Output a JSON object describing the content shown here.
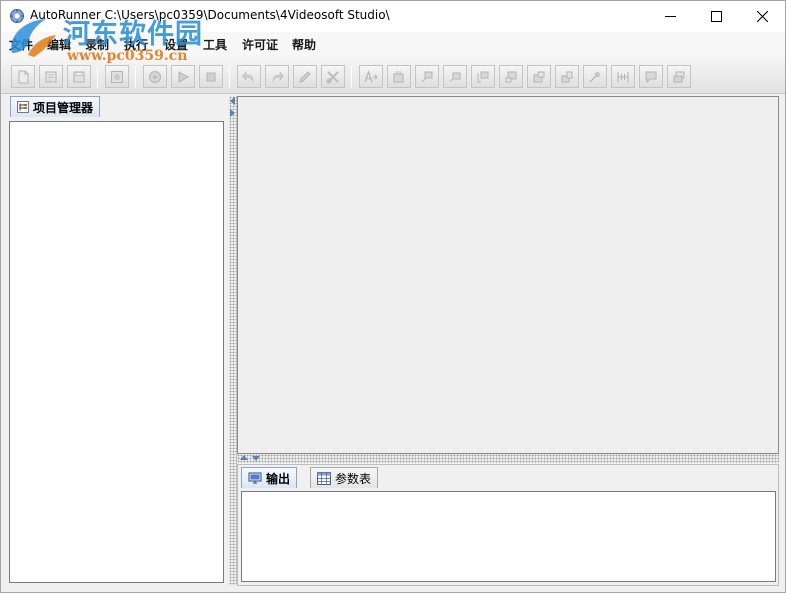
{
  "window": {
    "title": "AutoRunner  C:\\Users\\pc0359\\Documents\\4Videosoft Studio\\",
    "controls": {
      "minimize": "minimize-icon",
      "maximize": "maximize-icon",
      "close": "close-icon"
    }
  },
  "watermark": {
    "name": "河东软件园",
    "url": "www.pc0359.cn"
  },
  "menu": {
    "items": [
      {
        "label": "文件"
      },
      {
        "label": "编辑"
      },
      {
        "label": "录制"
      },
      {
        "label": "执行"
      },
      {
        "label": "设置"
      },
      {
        "label": "工具"
      },
      {
        "label": "许可证"
      },
      {
        "label": "帮助"
      }
    ]
  },
  "toolbar": {
    "buttons": [
      {
        "icon": "new-file-icon"
      },
      {
        "icon": "open-file-icon"
      },
      {
        "icon": "save-icon"
      },
      {
        "icon": "record-icon"
      },
      {
        "icon": "run-icon"
      },
      {
        "icon": "step-run-icon"
      },
      {
        "icon": "stop-icon"
      },
      {
        "icon": "undo-icon"
      },
      {
        "icon": "redo-icon"
      },
      {
        "icon": "edit-icon"
      },
      {
        "icon": "cut-icon"
      },
      {
        "icon": "text-icon"
      },
      {
        "icon": "find-icon"
      },
      {
        "icon": "format-1-icon"
      },
      {
        "icon": "format-2-icon"
      },
      {
        "icon": "format-3-icon"
      },
      {
        "icon": "format-4-icon"
      },
      {
        "icon": "format-5-icon"
      },
      {
        "icon": "format-6-icon"
      },
      {
        "icon": "compile-icon"
      },
      {
        "icon": "breakpoint-icon"
      },
      {
        "icon": "comment-icon"
      },
      {
        "icon": "window-icon"
      }
    ]
  },
  "project_panel": {
    "tab_label": "项目管理器"
  },
  "bottom_panel": {
    "tabs": [
      {
        "label": "输出"
      },
      {
        "label": "参数表"
      }
    ]
  },
  "colors": {
    "window_bg": "#f0f0f0",
    "tab_active_border": "#8ea4c6",
    "splitter_arrow": "#5a7fb5",
    "watermark_blue": "#2b8fd9",
    "watermark_orange": "#e07b16"
  }
}
